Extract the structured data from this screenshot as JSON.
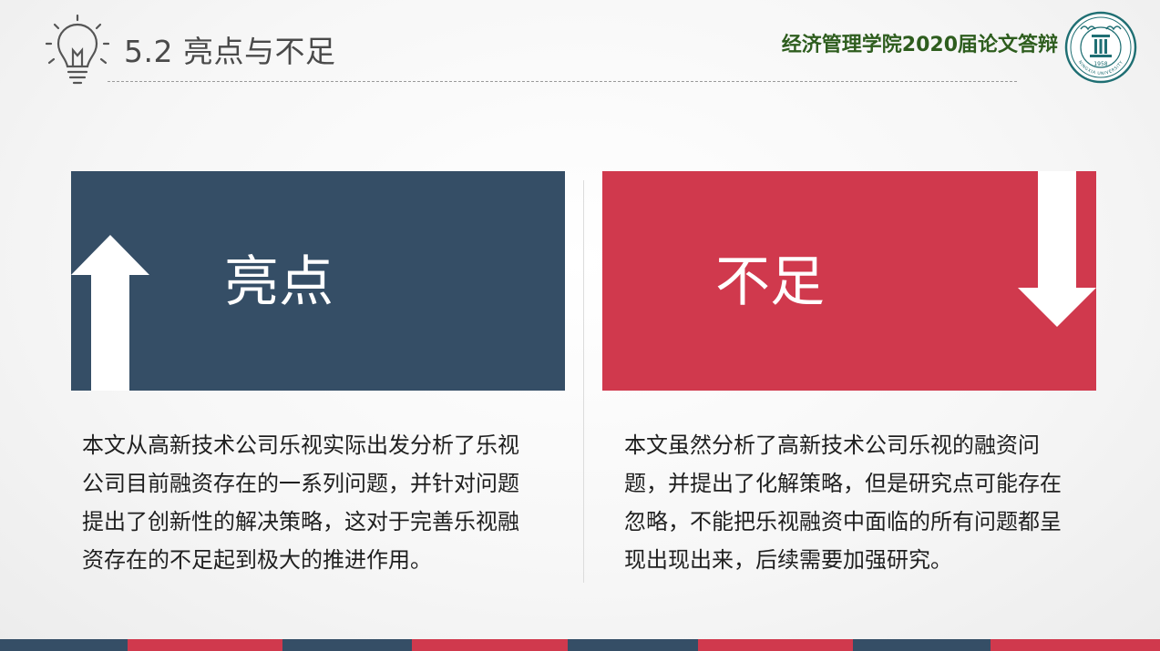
{
  "header": {
    "slide_title": "5.2 亮点与不足",
    "defense_title": "经济管理学院2020届论文答辩",
    "emblem": {
      "icon": "university-emblem",
      "text": "NINGXIA UNIVERSITY",
      "year": "1958"
    }
  },
  "strength": {
    "label": "亮点",
    "description": "本文从高新技术公司乐视实际出发分析了乐视公司目前融资存在的一系列问题，并针对问题提出了创新性的解决策略，这对于完善乐视融资存在的不足起到极大的推进作用。"
  },
  "weakness": {
    "label": "不足",
    "description": "本文虽然分析了高新技术公司乐视的融资问题，并提出了化解策略，但是研究点可能存在忽略，不能把乐视融资中面临的所有问题都呈现出现出来，后续需要加强研究。"
  },
  "colors": {
    "navy": "#354e66",
    "red": "#d0394d",
    "title_green": "#2e5d1e",
    "emblem_teal": "#1f6f73"
  }
}
